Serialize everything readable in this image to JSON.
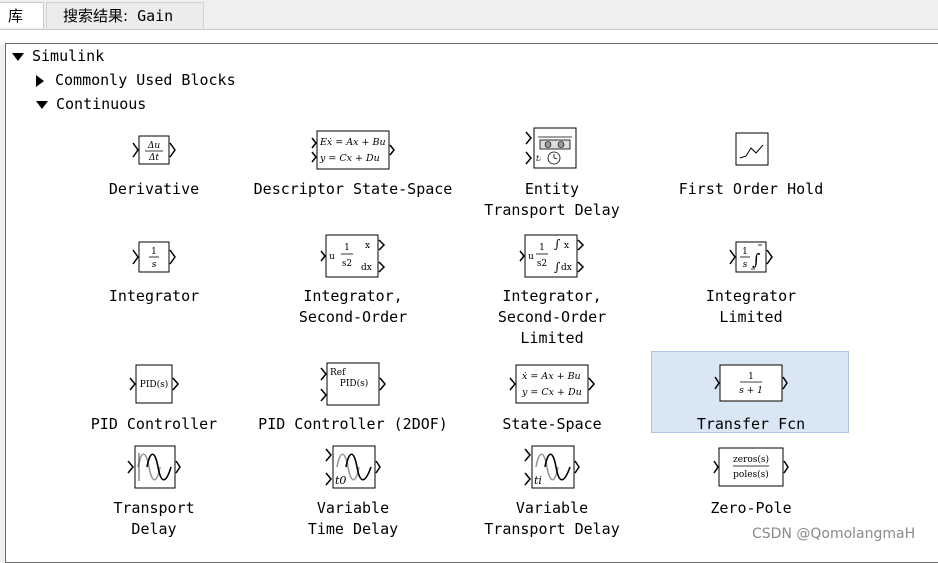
{
  "tabs": [
    {
      "label": "库"
    },
    {
      "label_prefix": "搜索结果:",
      "label_query": "Gain"
    }
  ],
  "tree": {
    "root": "Simulink",
    "commonly_used": "Commonly Used Blocks",
    "continuous": "Continuous"
  },
  "blocks": [
    {
      "name": "Derivative",
      "icon_text": [
        "Δu",
        "Δt"
      ]
    },
    {
      "name": "Descriptor State-Space",
      "icon_text": [
        "Eẋ = Ax + Bu",
        "y = Cx + Du"
      ]
    },
    {
      "name": "Entity\nTransport Delay",
      "icon_text": [
        "tᵢ"
      ]
    },
    {
      "name": "First Order Hold",
      "icon_text": []
    },
    {
      "name": "Integrator",
      "icon_text": [
        "1",
        "s"
      ]
    },
    {
      "name": "Integrator,\nSecond-Order",
      "icon_text": [
        "u",
        "1",
        "s2",
        "x",
        "dx"
      ]
    },
    {
      "name": "Integrator,\nSecond-Order\nLimited",
      "icon_text": [
        "u",
        "1",
        "s2",
        "x",
        "dx"
      ]
    },
    {
      "name": "Integrator\nLimited",
      "icon_text": [
        "1",
        "s"
      ]
    },
    {
      "name": "PID Controller",
      "icon_text": [
        "PID(s)"
      ]
    },
    {
      "name": "PID Controller (2DOF)",
      "icon_text": [
        "Ref",
        "PID(s)"
      ]
    },
    {
      "name": "State-Space",
      "icon_text": [
        "ẋ = Ax + Bu",
        "y = Cx + Du"
      ]
    },
    {
      "name": "Transfer Fcn",
      "icon_text": [
        "1",
        "s + 1"
      ]
    },
    {
      "name": "Transport\nDelay",
      "icon_text": []
    },
    {
      "name": "Variable\nTime Delay",
      "icon_text": [
        "t0"
      ]
    },
    {
      "name": "Variable\nTransport Delay",
      "icon_text": [
        "ti"
      ]
    },
    {
      "name": "Zero-Pole",
      "icon_text": [
        "zeros(s)",
        "poles(s)"
      ]
    }
  ],
  "selected_block": "Transfer Fcn",
  "watermark": "CSDN @QomolangmaH"
}
